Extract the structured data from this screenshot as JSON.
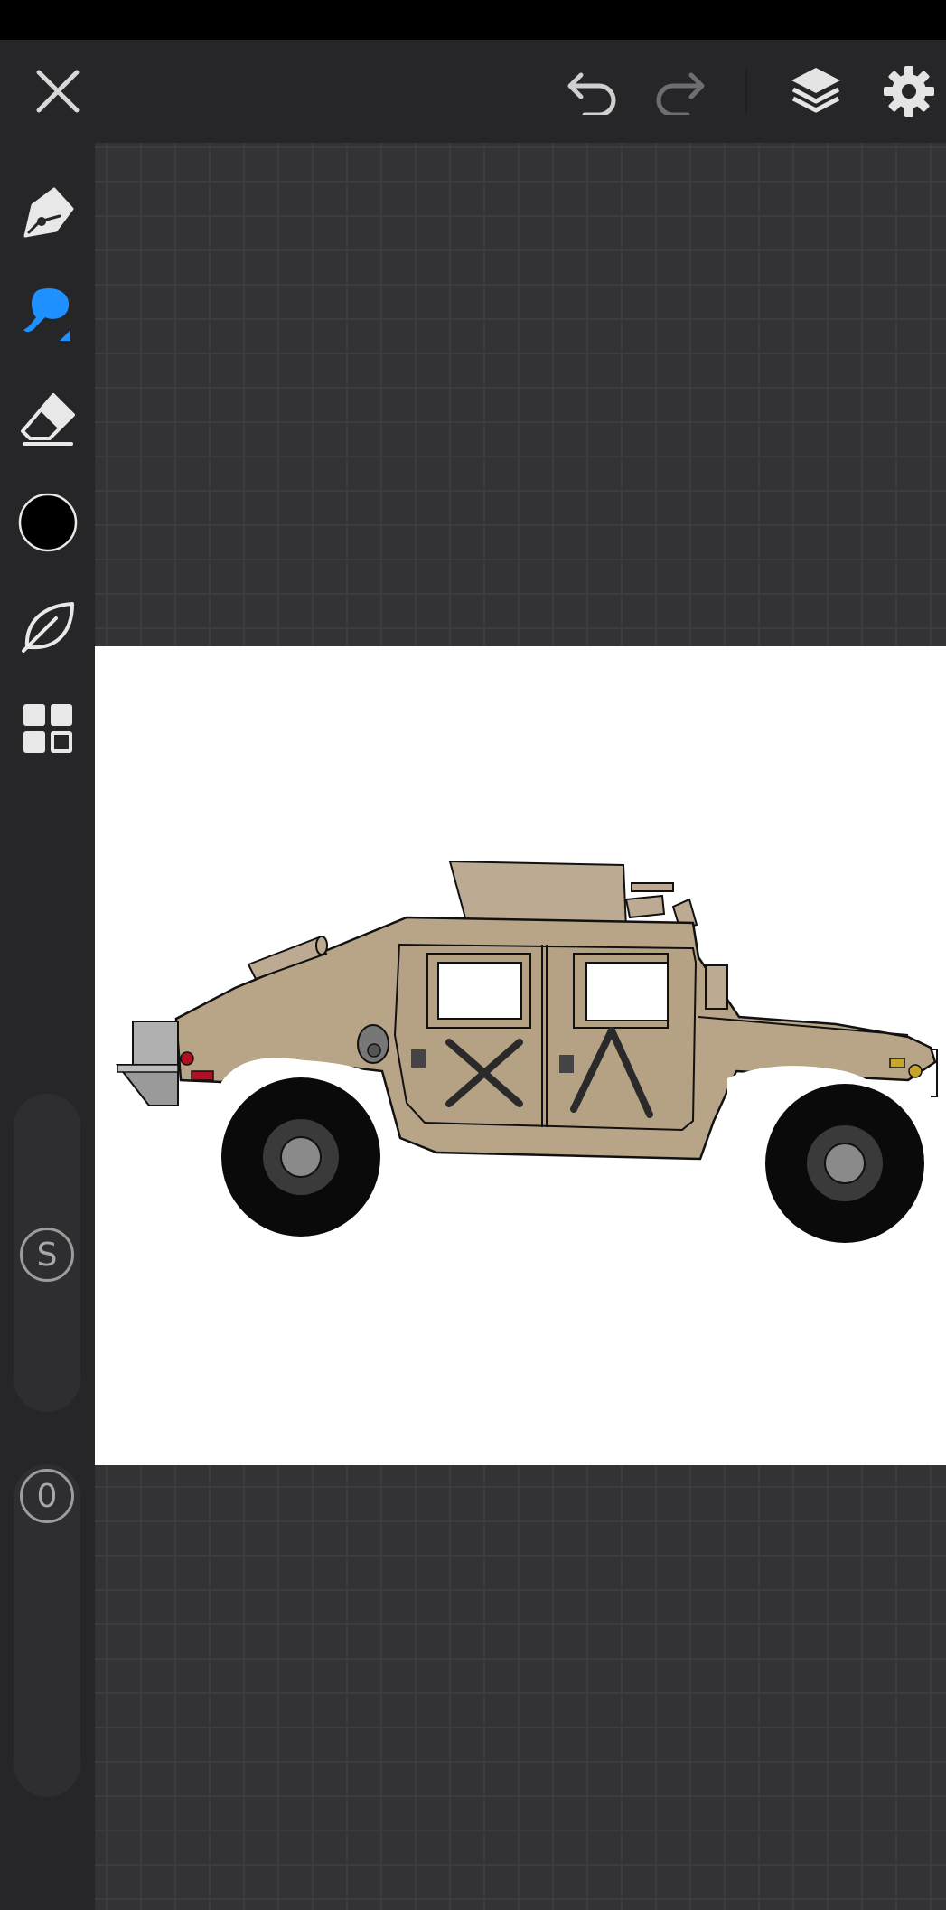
{
  "toolbar": {
    "close_icon": "close-icon",
    "undo_icon": "undo-icon",
    "redo_icon": "redo-icon",
    "layers_icon": "layers-icon",
    "settings_icon": "gear-icon"
  },
  "tools": [
    {
      "name": "pen",
      "icon": "pen-nib-icon",
      "active": false
    },
    {
      "name": "brush",
      "icon": "brush-icon",
      "active": true
    },
    {
      "name": "eraser",
      "icon": "eraser-icon",
      "active": false
    },
    {
      "name": "color",
      "icon": "color-circle-icon",
      "active": false
    },
    {
      "name": "smudge",
      "icon": "leaf-icon",
      "active": false
    },
    {
      "name": "more",
      "icon": "grid-icon",
      "active": false
    }
  ],
  "size_slider": {
    "label": "S"
  },
  "opacity_slider": {
    "label": "0"
  },
  "colors": {
    "accent": "#1e90ff",
    "toolbar_bg": "#262628",
    "canvas_bg": "#333335",
    "vehicle_tan": "#b8a487",
    "wheel": "#0a0a0a"
  },
  "artwork": {
    "subject": "humvee-drawing"
  }
}
